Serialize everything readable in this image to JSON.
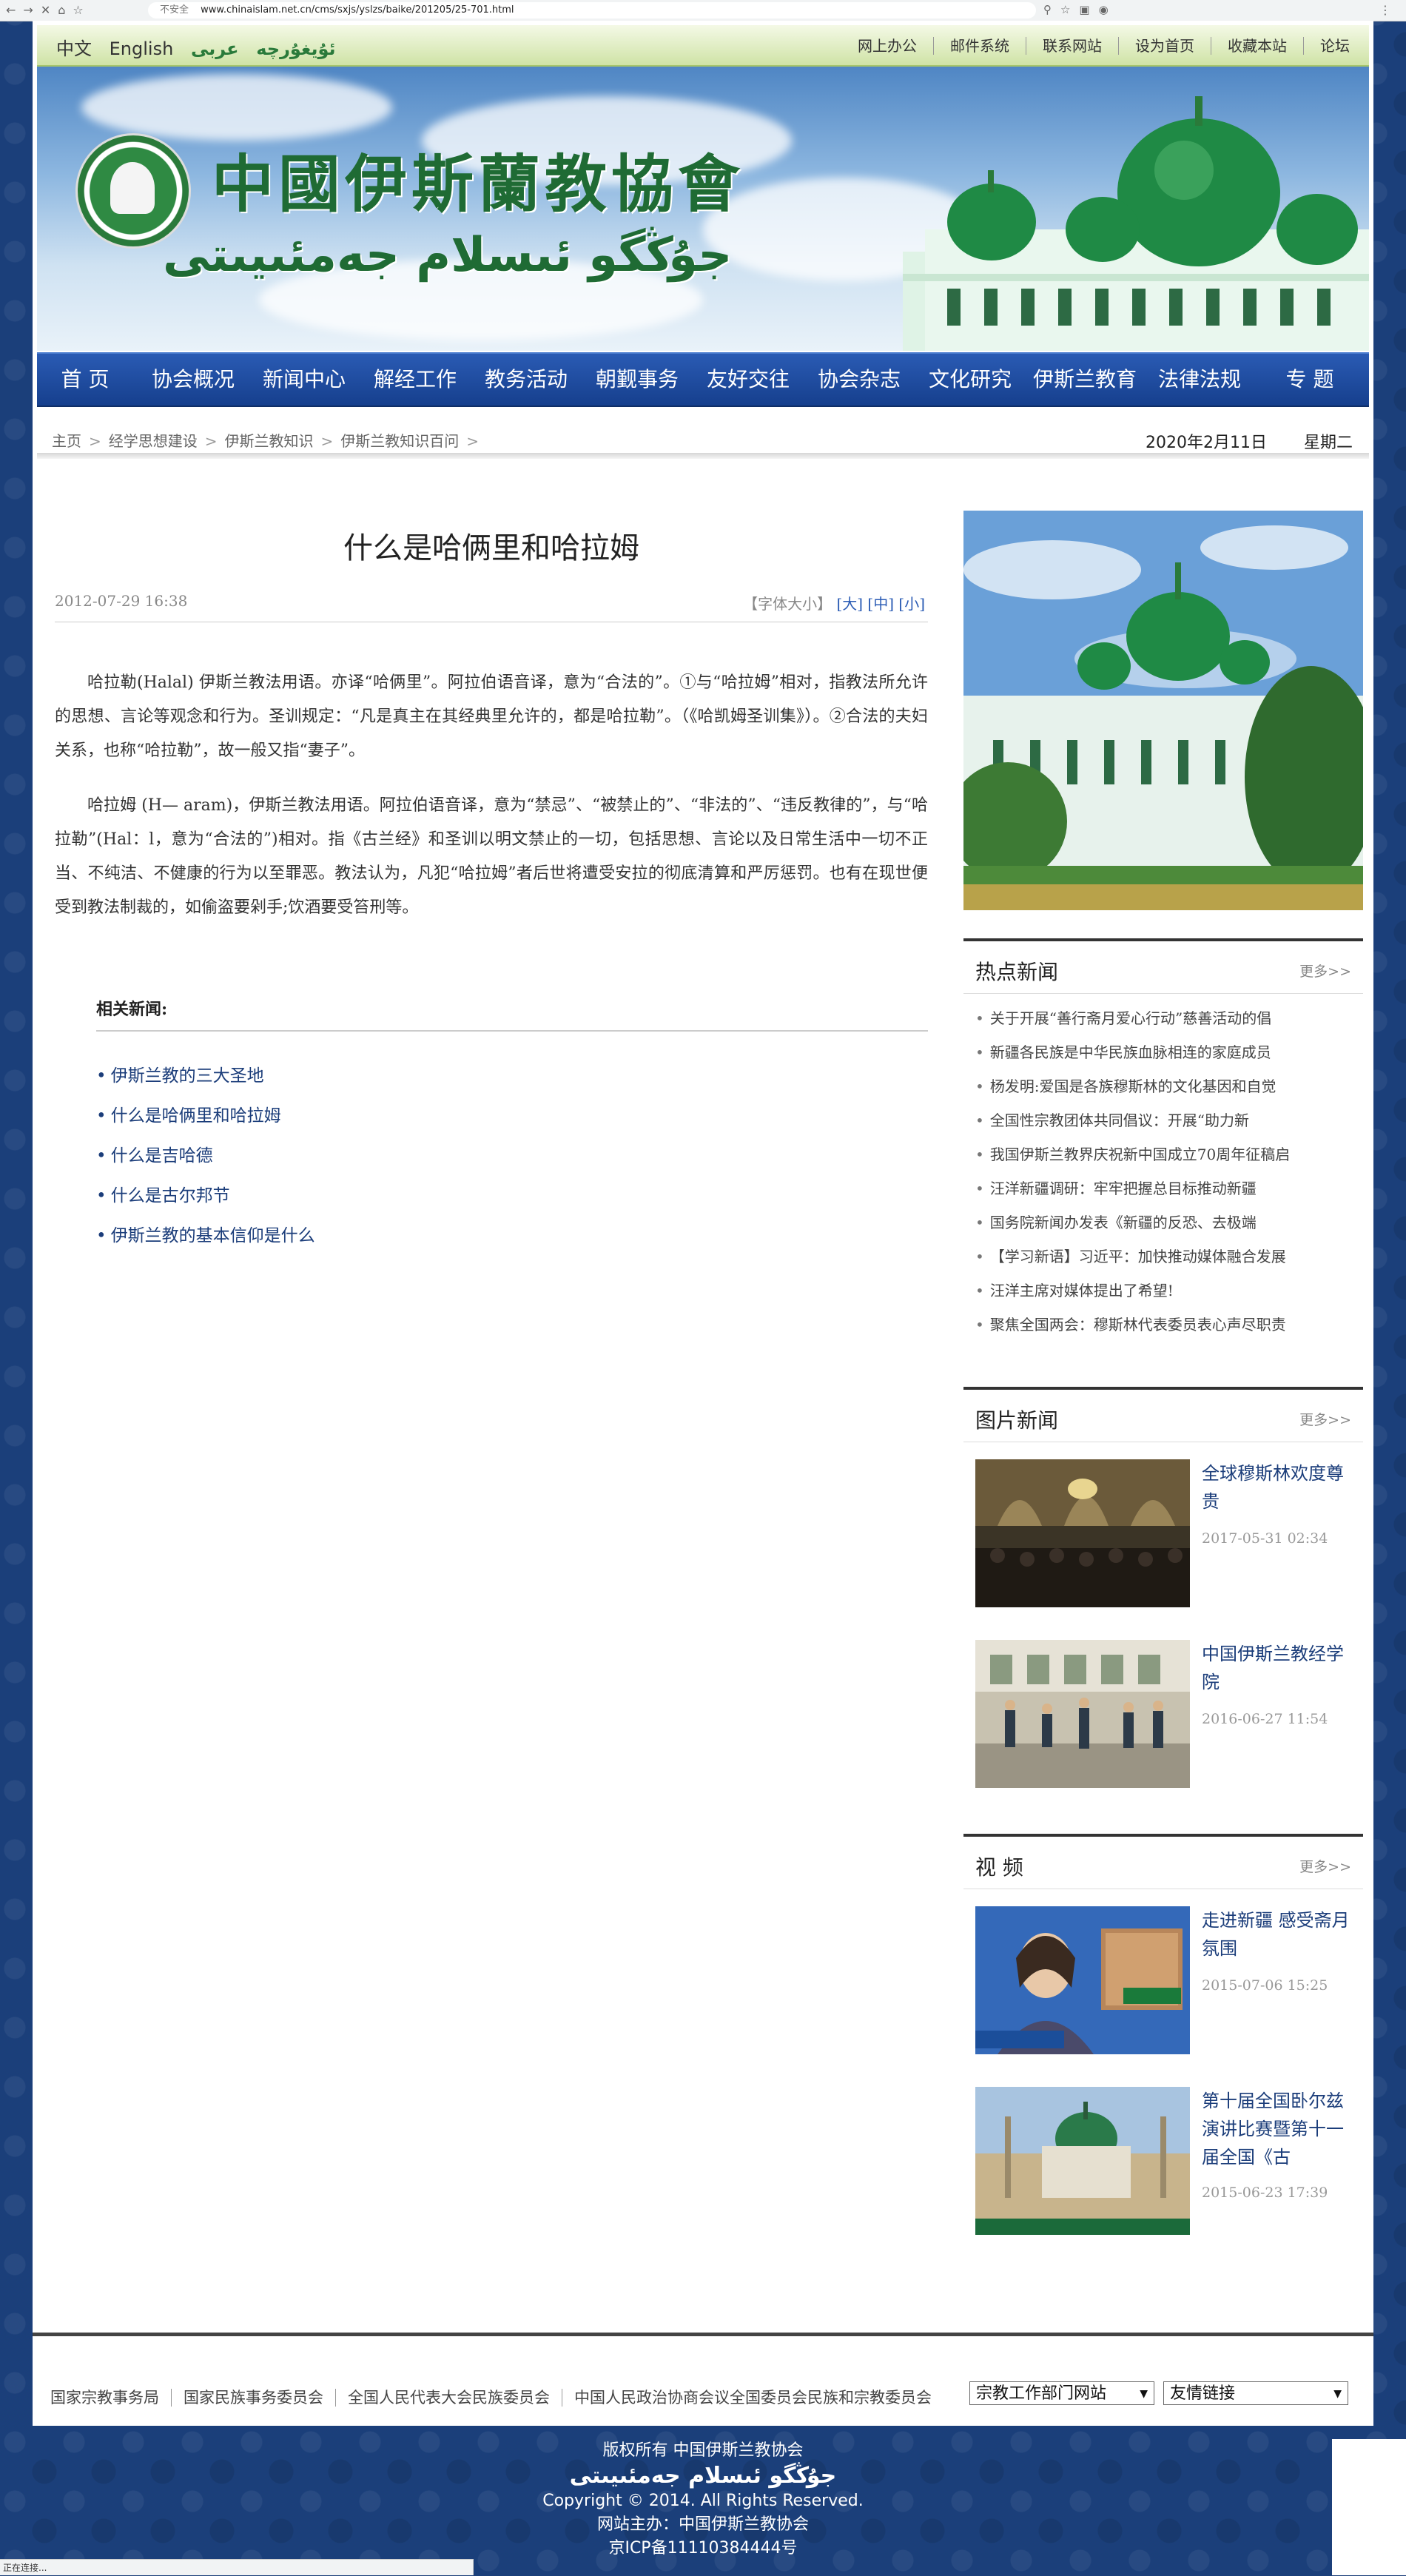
{
  "browser": {
    "url": "www.chinaislam.net.cn/cms/sxjs/yslzs/baike/201205/25-701.html",
    "insecure_label": "不安全",
    "status": "正在连接..."
  },
  "topbar": {
    "lang_cn": "中文",
    "lang_en": "English",
    "lang_ug": "ئۇيغۇرچە",
    "lang_ar": "عربى",
    "links": [
      "网上办公",
      "邮件系统",
      "联系网站",
      "设为首页",
      "收藏本站",
      "论坛"
    ]
  },
  "banner": {
    "title_cn": "中國伊斯蘭教協會",
    "title_ug": "جۇڭگو ئىسلام جەمئىيىتى"
  },
  "nav": [
    "首 页",
    "协会概况",
    "新闻中心",
    "解经工作",
    "教务活动",
    "朝觐事务",
    "友好交往",
    "协会杂志",
    "文化研究",
    "伊斯兰教育",
    "法律法规",
    "专 题"
  ],
  "breadcrumb": [
    "主页",
    "经学思想建设",
    "伊斯兰教知识",
    "伊斯兰教知识百问"
  ],
  "date": {
    "text": "2020年2月11日",
    "weekday": "星期二"
  },
  "article": {
    "title": "什么是哈俩里和哈拉姆",
    "time": "2012-07-29 16:38",
    "font_label": "【字体大小】",
    "font_large": "[大]",
    "font_medium": "[中]",
    "font_small": "[小]",
    "paragraphs": [
      "哈拉勒(Halal) 伊斯兰教法用语。亦译“哈俩里”。阿拉伯语音译，意为“合法的”。①与“哈拉姆”相对，指教法所允许的思想、言论等观念和行为。圣训规定：“凡是真主在其经典里允许的，都是哈拉勒”。（《哈凯姆圣训集》）。②合法的夫妇关系，也称“哈拉勒”，故一般又指“妻子”。",
      "哈拉姆 (H— aram)，伊斯兰教法用语。阿拉伯语音译，意为“禁忌”、“被禁止的”、“非法的”、“违反教律的”，与“哈拉勒”(Hal：l，意为“合法的”)相对。指《古兰经》和圣训以明文禁止的一切，包括思想、言论以及日常生活中一切不正当、不纯洁、不健康的行为以至罪恶。教法认为，凡犯“哈拉姆”者后世将遭受安拉的彻底清算和严厉惩罚。也有在现世便受到教法制裁的，如偷盗要剁手;饮酒要受笞刑等。"
    ],
    "related_heading": "相关新闻:",
    "related": [
      "伊斯兰教的三大圣地",
      "什么是哈俩里和哈拉姆",
      "什么是吉哈德",
      "什么是古尔邦节",
      "伊斯兰教的基本信仰是什么"
    ]
  },
  "sidebar": {
    "hot": {
      "title": "热点新闻",
      "more": "更多>>",
      "items": [
        "关于开展“善行斋月爱心行动”慈善活动的倡",
        "新疆各民族是中华民族血脉相连的家庭成员",
        "杨发明:爱国是各族穆斯林的文化基因和自觉",
        "全国性宗教团体共同倡议：开展“助力新",
        "我国伊斯兰教界庆祝新中国成立70周年征稿启",
        "汪洋新疆调研：牢牢把握总目标推动新疆",
        "国务院新闻办发表《新疆的反恐、去极端",
        "【学习新语】习近平：加快推动媒体融合发展",
        "汪洋主席对媒体提出了希望!",
        "聚焦全国两会：穆斯林代表委员表心声尽职责"
      ]
    },
    "pics": {
      "title": "图片新闻",
      "more": "更多>>",
      "items": [
        {
          "caption": "全球穆斯林欢度尊贵",
          "time": "2017-05-31 02:34"
        },
        {
          "caption": "中国伊斯兰教经学院",
          "time": "2016-06-27 11:54"
        }
      ]
    },
    "video": {
      "title": "视 频",
      "more": "更多>>",
      "items": [
        {
          "caption": "走进新疆 感受斋月氛围",
          "time": "2015-07-06 15:25"
        },
        {
          "caption": "第十届全国卧尔兹演讲比赛暨第十一届全国《古",
          "time": "2015-06-23 17:39"
        }
      ]
    }
  },
  "footer": {
    "links": [
      "国家宗教事务局",
      "国家民族事务委员会",
      "全国人民代表大会民族委员会",
      "中国人民政治协商会议全国委员会民族和宗教委员会"
    ],
    "select1": "宗教工作部门网站",
    "select2": "友情链接",
    "copyright_cn": "版权所有 中国伊斯兰教协会",
    "copyright_ug": "جۇڭگو ئىسلام جەمئىيىتى",
    "copyright_en": "Copyright © 2014. All Rights Reserved.",
    "host": "网站主办：中国伊斯兰教协会",
    "icp": "京ICP备11110384444号"
  }
}
